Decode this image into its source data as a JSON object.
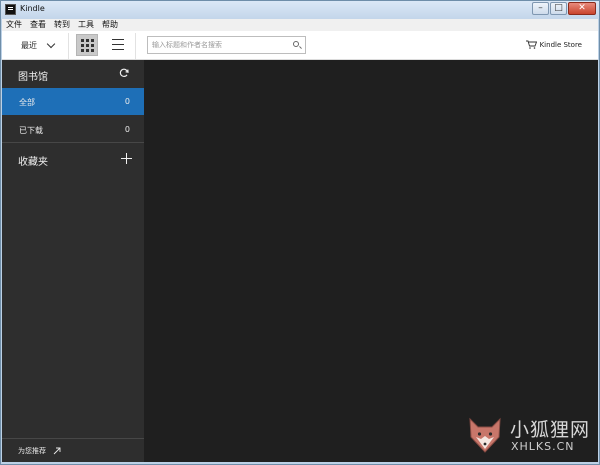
{
  "window": {
    "title": "Kindle",
    "controls": [
      "–",
      "□",
      "✕"
    ]
  },
  "menu": [
    "文件",
    "查看",
    "转到",
    "工具",
    "帮助"
  ],
  "toolbar": {
    "sort_label": "最近",
    "search_placeholder": "输入标题和作者名搜索",
    "store_label": "Kindle Store"
  },
  "sidebar": {
    "library_title": "图书馆",
    "items": [
      {
        "label": "全部",
        "count": "0",
        "selected": true
      },
      {
        "label": "已下载",
        "count": "0",
        "selected": false
      }
    ],
    "collections_label": "收藏夹",
    "recommend_label": "为您推荐"
  },
  "watermark": {
    "cn": "小狐狸网",
    "en": "XHLKS.CN"
  },
  "colors": {
    "sidebar_bg": "#2e2e2e",
    "selected_bg": "#1e6fb7",
    "main_bg": "#1f1f1f",
    "toolbar_bg": "#ffffff"
  }
}
